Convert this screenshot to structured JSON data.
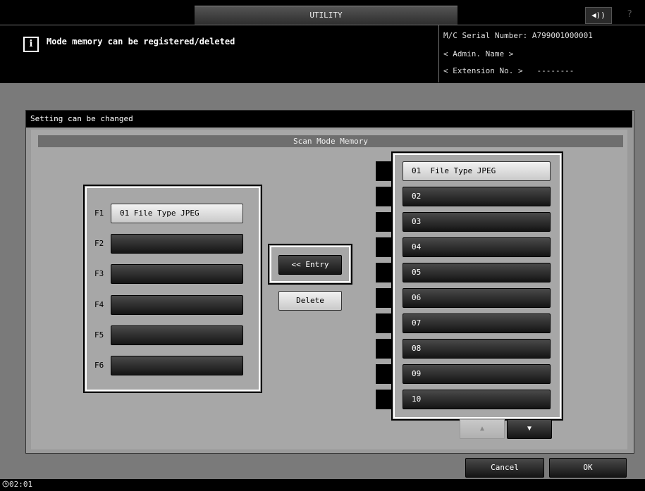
{
  "header": {
    "tab_title": "UTILITY",
    "sound_icon": "speaker-icon",
    "sound_label": "◀))",
    "help_label": "?"
  },
  "message": {
    "icon": "info-icon",
    "icon_label": "i",
    "text": "Mode memory can be registered/deleted",
    "serial_line": "M/C Serial Number: A799001000001",
    "admin_line": "< Admin. Name >",
    "extension_line": "< Extension No. >   --------"
  },
  "settings": {
    "status": "Setting can be changed",
    "section_title": "Scan Mode Memory"
  },
  "function_keys": [
    {
      "label": "F1",
      "value": "01 File Type JPEG"
    },
    {
      "label": "F2",
      "value": ""
    },
    {
      "label": "F3",
      "value": ""
    },
    {
      "label": "F4",
      "value": ""
    },
    {
      "label": "F5",
      "value": ""
    },
    {
      "label": "F6",
      "value": ""
    }
  ],
  "actions": {
    "entry": "<< Entry",
    "delete": "Delete"
  },
  "memory_list": [
    {
      "label": "01  File Type JPEG"
    },
    {
      "label": "02"
    },
    {
      "label": "03"
    },
    {
      "label": "04"
    },
    {
      "label": "05"
    },
    {
      "label": "06"
    },
    {
      "label": "07"
    },
    {
      "label": "08"
    },
    {
      "label": "09"
    },
    {
      "label": "10"
    }
  ],
  "pager": {
    "up_label": "▲",
    "down_label": "▼"
  },
  "footer": {
    "cancel": "Cancel",
    "ok": "OK",
    "clock_icon": "clock-icon",
    "time": "02:01"
  }
}
